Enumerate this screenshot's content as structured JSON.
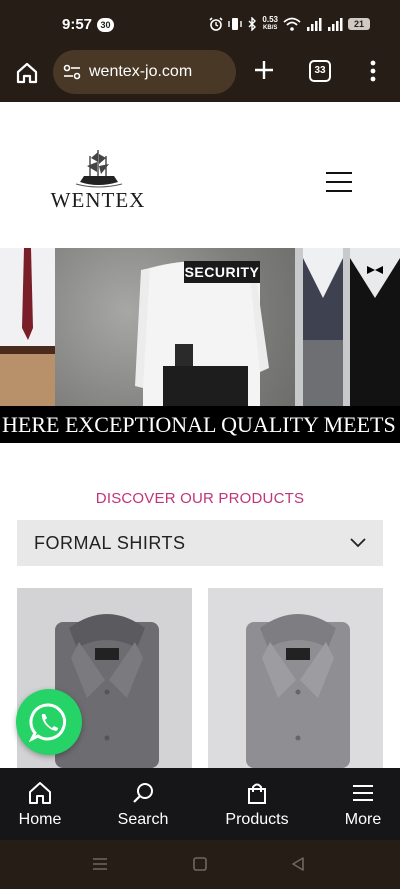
{
  "status_bar": {
    "time": "9:57",
    "notification_badge": "30",
    "net_speed_value": "0.53",
    "net_speed_unit": "KB/S",
    "battery": "21"
  },
  "browser": {
    "url": "wentex-jo.com",
    "tab_count": "33"
  },
  "site": {
    "logo_text": "WENTEX",
    "banner_label": "SECURITY",
    "marquee_text": "HERE EXCEPTIONAL QUALITY MEETS F"
  },
  "products": {
    "heading": "DISCOVER OUR PRODUCTS",
    "selected_category": "FORMAL SHIRTS",
    "shirt_colors": [
      "#6d6c70",
      "#8f8f93"
    ]
  },
  "bottom_nav": {
    "items": [
      {
        "label": "Home",
        "icon": "home-icon"
      },
      {
        "label": "Search",
        "icon": "search-icon"
      },
      {
        "label": "Products",
        "icon": "shopping-bag-icon"
      },
      {
        "label": "More",
        "icon": "menu-icon"
      }
    ]
  },
  "colors": {
    "chrome_bg": "#261d16",
    "accent_pink": "#c0347a",
    "whatsapp_green": "#25d366"
  }
}
